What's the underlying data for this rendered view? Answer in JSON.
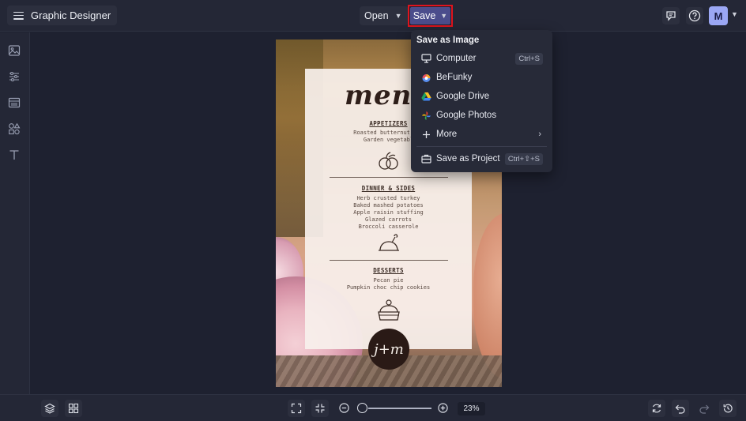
{
  "app": {
    "title": "Graphic Designer"
  },
  "topbar": {
    "open_label": "Open",
    "save_label": "Save",
    "avatar_initial": "M"
  },
  "save_menu": {
    "heading": "Save as Image",
    "items": [
      {
        "label": "Computer",
        "shortcut": "Ctrl+S",
        "icon": "monitor-icon"
      },
      {
        "label": "BeFunky",
        "shortcut": "",
        "icon": "befunky-icon"
      },
      {
        "label": "Google Drive",
        "shortcut": "",
        "icon": "google-drive-icon"
      },
      {
        "label": "Google Photos",
        "shortcut": "",
        "icon": "google-photos-icon"
      },
      {
        "label": "More",
        "shortcut": "",
        "icon": "plus-icon"
      }
    ],
    "project": {
      "label": "Save as Project",
      "shortcut": "Ctrl+⇧+S",
      "icon": "briefcase-icon"
    }
  },
  "design": {
    "title": "menu",
    "sections": [
      {
        "heading": "APPETIZERS",
        "items": [
          "Roasted butternut squ",
          "Garden vegetabl"
        ]
      },
      {
        "heading": "DINNER & SIDES",
        "items": [
          "Herb crusted turkey",
          "Baked mashed potatoes",
          "Apple raisin stuffing",
          "Glazed carrots",
          "Broccoli casserole"
        ]
      },
      {
        "heading": "DESSERTS",
        "items": [
          "Pecan pie",
          "Pumpkin choc chip cookies"
        ]
      }
    ],
    "monogram": "j+m"
  },
  "bottombar": {
    "zoom": "23%"
  },
  "colors": {
    "accent": "#4b4d8c",
    "highlight": "#e0141d",
    "background": "#1e2130"
  }
}
